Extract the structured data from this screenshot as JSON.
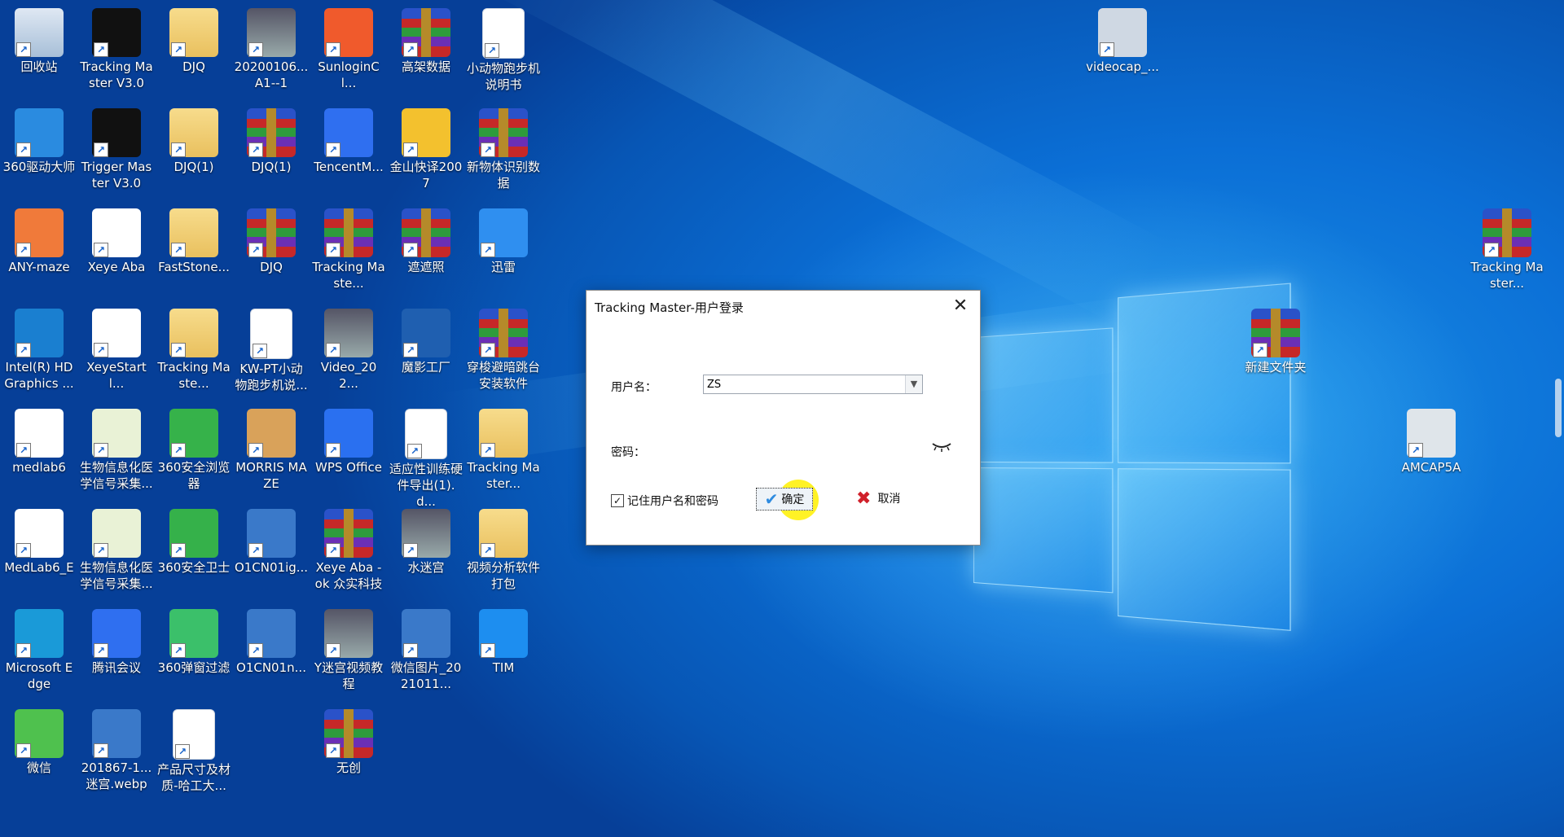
{
  "desktop": {
    "icons": [
      {
        "label": "回收站",
        "icon": "recycle-bin-icon"
      },
      {
        "label": "Tracking Master V3.0",
        "icon": "tracking-master-icon"
      },
      {
        "label": "DJQ",
        "icon": "folder-icon"
      },
      {
        "label": "20200106... A1--1",
        "icon": "video-file-icon"
      },
      {
        "label": "SunloginCl...",
        "icon": "sunlogin-icon"
      },
      {
        "label": "高架数据",
        "icon": "archive-icon"
      },
      {
        "label": "小动物跑步机说明书",
        "icon": "wps-doc-icon"
      },
      {
        "label": "360驱动大师",
        "icon": "driver-master-icon"
      },
      {
        "label": "Trigger Master V3.0",
        "icon": "trigger-master-icon"
      },
      {
        "label": "DJQ(1)",
        "icon": "folder-icon"
      },
      {
        "label": "DJQ(1)",
        "icon": "archive-icon"
      },
      {
        "label": "TencentM...",
        "icon": "tencent-meeting-icon"
      },
      {
        "label": "金山快译2007",
        "icon": "kingsoft-icon"
      },
      {
        "label": "新物体识别数据",
        "icon": "archive-icon"
      },
      {
        "label": "ANY-maze",
        "icon": "anymaze-icon"
      },
      {
        "label": "Xeye Aba",
        "icon": "xeye-icon"
      },
      {
        "label": "FastStone...",
        "icon": "folder-icon"
      },
      {
        "label": "DJQ",
        "icon": "archive-icon"
      },
      {
        "label": "Tracking Maste...",
        "icon": "archive-icon"
      },
      {
        "label": "遮遮照",
        "icon": "archive-icon"
      },
      {
        "label": "迅雷",
        "icon": "xunlei-icon"
      },
      {
        "label": "Intel(R) HD Graphics ...",
        "icon": "intel-graphics-icon"
      },
      {
        "label": "XeyeStartl...",
        "icon": "xeye-start-icon"
      },
      {
        "label": "Tracking Maste...",
        "icon": "folder-icon"
      },
      {
        "label": "KW-PT小动物跑步机说...",
        "icon": "word-doc-icon"
      },
      {
        "label": "Video_202...",
        "icon": "video-file-icon"
      },
      {
        "label": "魔影工厂",
        "icon": "video-factory-icon"
      },
      {
        "label": "穿梭避暗跳台安装软件",
        "icon": "archive-icon"
      },
      {
        "label": "medlab6",
        "icon": "medlab-icon"
      },
      {
        "label": "生物信息化医学信号采集...",
        "icon": "bio-signal-icon"
      },
      {
        "label": "360安全浏览器",
        "icon": "browser-360-icon"
      },
      {
        "label": "MORRIS MAZE",
        "icon": "morris-maze-icon"
      },
      {
        "label": "WPS Office",
        "icon": "wps-office-icon"
      },
      {
        "label": "适应性训练硬件导出(1).d...",
        "icon": "blank-doc-icon"
      },
      {
        "label": "Tracking Master...",
        "icon": "folder-icon"
      },
      {
        "label": "MedLab6_E",
        "icon": "medlab-icon"
      },
      {
        "label": "生物信息化医学信号采集...",
        "icon": "bio-signal-icon"
      },
      {
        "label": "360安全卫士",
        "icon": "security-360-icon"
      },
      {
        "label": "O1CN01ig...",
        "icon": "image-file-icon"
      },
      {
        "label": "Xeye Aba - ok 众实科技",
        "icon": "archive-icon"
      },
      {
        "label": "水迷宫",
        "icon": "video-file-icon"
      },
      {
        "label": "视频分析软件打包",
        "icon": "folder-icon"
      },
      {
        "label": "Microsoft Edge",
        "icon": "edge-icon"
      },
      {
        "label": "腾讯会议",
        "icon": "tencent-meeting-icon"
      },
      {
        "label": "360弹窗过滤",
        "icon": "popup-filter-icon"
      },
      {
        "label": "O1CN01n...",
        "icon": "image-file-icon"
      },
      {
        "label": "Y迷宫视频教程",
        "icon": "video-file-icon"
      },
      {
        "label": "微信图片_2021011...",
        "icon": "image-file-icon"
      },
      {
        "label": "TIM",
        "icon": "tim-icon"
      },
      {
        "label": "微信",
        "icon": "wechat-icon"
      },
      {
        "label": "201867-1... 迷宫.webp",
        "icon": "image-file-icon"
      },
      {
        "label": "产品尺寸及材质-哈工大...",
        "icon": "word-doc-icon"
      },
      {
        "label": "无创",
        "icon": "archive-icon"
      },
      {
        "label": "videocap_...",
        "icon": "videocap-icon"
      },
      {
        "label": "Tracking Master...",
        "icon": "archive-icon"
      },
      {
        "label": "新建文件夹",
        "icon": "archive-icon"
      },
      {
        "label": "AMCAP5A",
        "icon": "amcap-icon"
      }
    ]
  },
  "dialog": {
    "title": "Tracking Master-用户登录",
    "username_label": "用户名：",
    "username_value": "ZS",
    "password_label": "密码：",
    "remember_label": "记住用户名和密码",
    "remember_checked": true,
    "ok_label": "确定",
    "cancel_label": "取消"
  },
  "colors": {
    "accent": "#2e8be0",
    "cancel": "#d0202a",
    "highlight": "#fff000"
  }
}
